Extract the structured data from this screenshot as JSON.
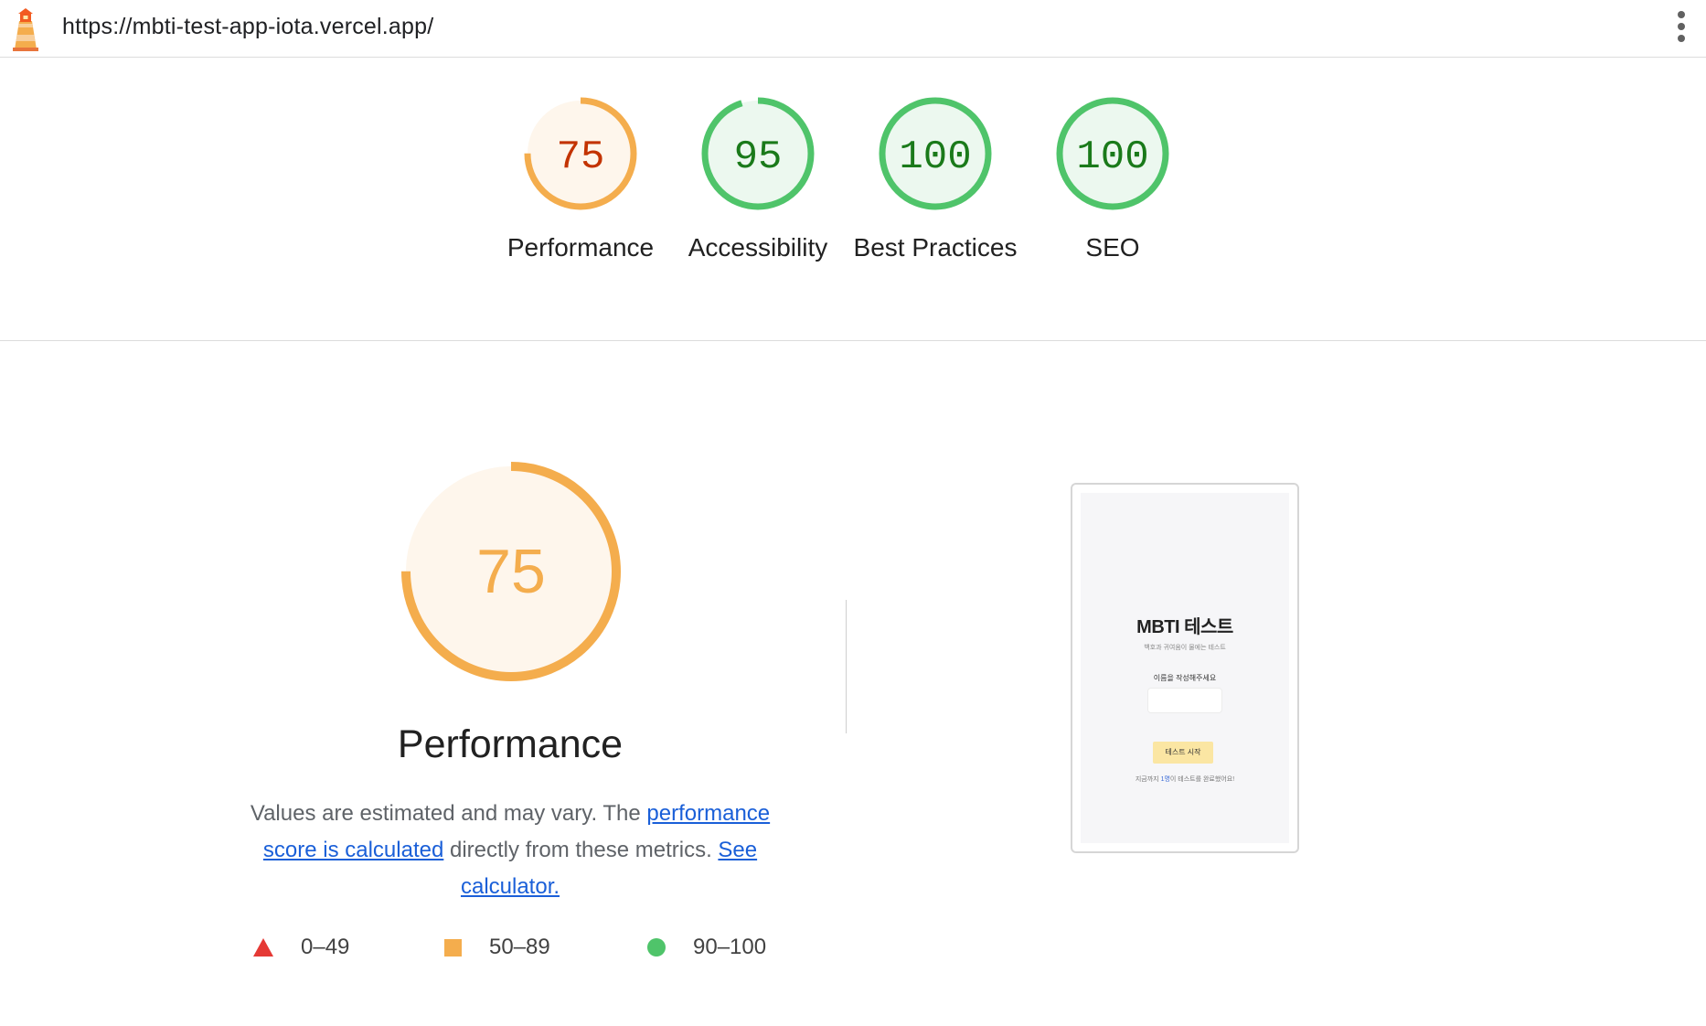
{
  "topbar": {
    "url": "https://mbti-test-app-iota.vercel.app/",
    "logo_icon": "lighthouse-icon",
    "menu_icon": "more-vertical-icon"
  },
  "colors": {
    "average": "#f4ad4d",
    "average_text": "#c33300",
    "average_fill": "#fef6ec",
    "pass": "#4fc46a",
    "pass_text": "#1a7a1a",
    "pass_fill": "#ecf8ef",
    "fail": "#e53935",
    "link": "#1a5fd8"
  },
  "gauges": [
    {
      "score": "75",
      "value": 75,
      "label": "Performance",
      "status": "average"
    },
    {
      "score": "95",
      "value": 95,
      "label": "Accessibility",
      "status": "pass"
    },
    {
      "score": "100",
      "value": 100,
      "label": "Best Practices",
      "status": "pass"
    },
    {
      "score": "100",
      "value": 100,
      "label": "SEO",
      "status": "pass"
    }
  ],
  "performance": {
    "score": "75",
    "value": 75,
    "title": "Performance",
    "desc_1": "Values are estimated and may vary. The ",
    "link_1": "performance score is calculated",
    "desc_2": " directly from these metrics. ",
    "link_2": "See calculator."
  },
  "legend": [
    {
      "icon": "triangle-icon",
      "range": "0–49"
    },
    {
      "icon": "square-icon",
      "range": "50–89"
    },
    {
      "icon": "circle-icon",
      "range": "90–100"
    }
  ],
  "screenshot": {
    "title": "MBTI 테스트",
    "subtitle": "백호과 귀여움이 물에는 테스트",
    "input_label": "이름을 작성해주세요",
    "button": "테스트 시작",
    "footer_pre": "지금까지 ",
    "footer_count": "1명",
    "footer_post": "이 테스트를 완료했어요!"
  }
}
